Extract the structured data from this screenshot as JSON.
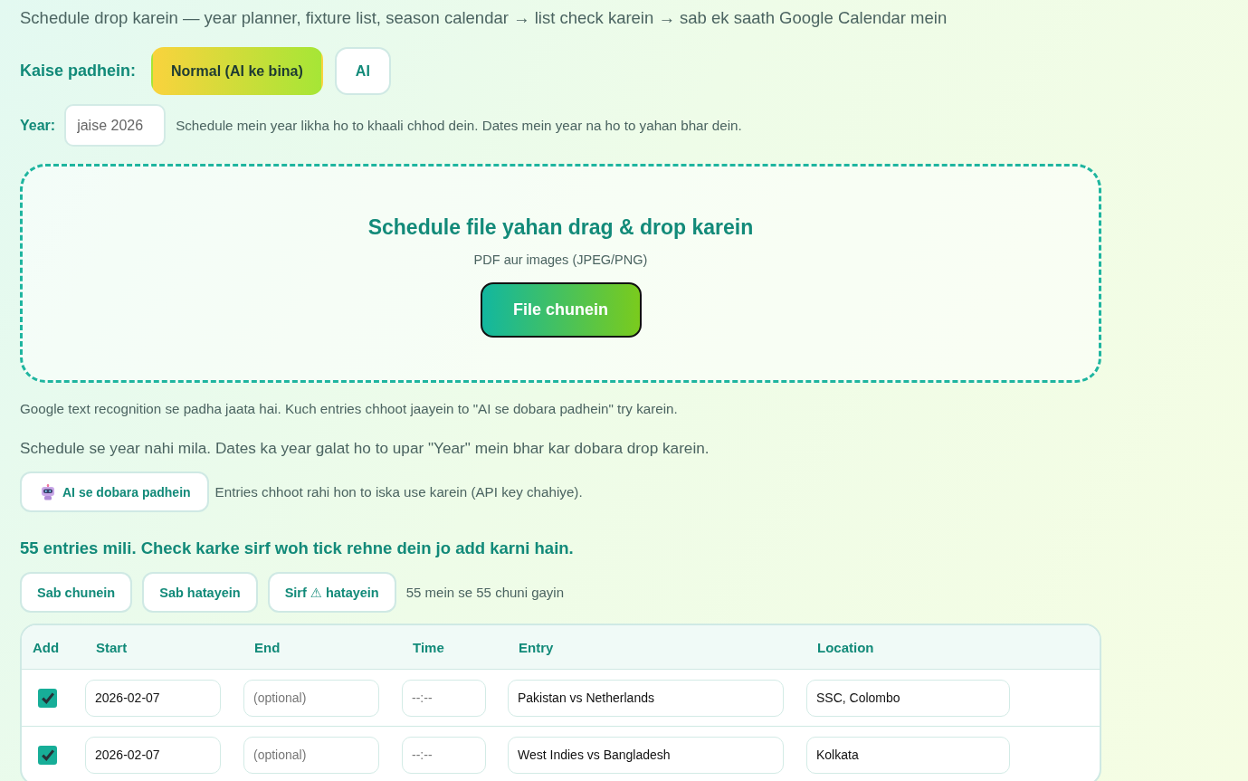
{
  "intro": "Schedule drop karein — year planner, fixture list, season calendar → list check karein → sab ek saath Google Calendar mein",
  "read_mode": {
    "label": "Kaise padhein:",
    "options": [
      {
        "label": "Normal (AI ke bina)",
        "selected": true
      },
      {
        "label": "AI",
        "selected": false
      }
    ]
  },
  "year": {
    "label": "Year:",
    "placeholder": "jaise 2026",
    "hint": "Schedule mein year likha ho to khaali chhod dein. Dates mein year na ho to yahan bhar dein."
  },
  "drop_zone": {
    "title": "Schedule file yahan drag & drop karein",
    "subtitle": "PDF aur images (JPEG/PNG)",
    "button": "File chunein"
  },
  "ocr_note": "Google text recognition se padha jaata hai. Kuch entries chhoot jaayein to \"AI se dobara padhein\" try karein.",
  "year_warning": "Schedule se year nahi mila. Dates ka year galat ho to upar \"Year\" mein bhar kar dobara drop karein.",
  "ai_reread": {
    "button": "AI se dobara padhein",
    "hint": "Entries chhoot rahi hon to iska use karein (API key chahiye)."
  },
  "results": {
    "heading": "55 entries mili. Check karke sirf woh tick rehne dein jo add karni hain.",
    "actions": [
      "Sab chunein",
      "Sab hatayein",
      "Sirf ⚠ hatayein"
    ],
    "selection_count": "55 mein se 55 chuni gayin"
  },
  "table": {
    "columns": [
      "Add",
      "Start",
      "End",
      "Time",
      "Entry",
      "Location"
    ],
    "rows": [
      {
        "checked": true,
        "start": "2026-02-07",
        "end_placeholder": "(optional)",
        "time_placeholder": "--:--",
        "entry": "Pakistan vs Netherlands",
        "location": "SSC, Colombo"
      },
      {
        "checked": true,
        "start": "2026-02-07",
        "end_placeholder": "(optional)",
        "time_placeholder": "--:--",
        "entry": "West Indies vs Bangladesh",
        "location": "Kolkata"
      }
    ]
  }
}
